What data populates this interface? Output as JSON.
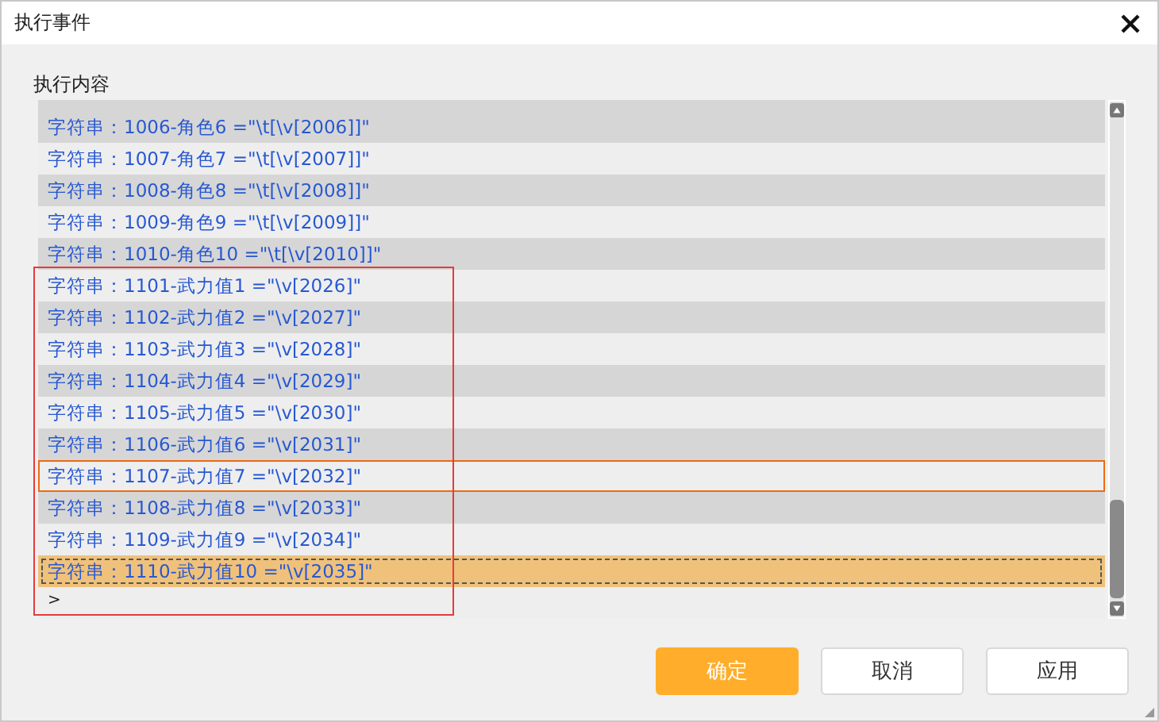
{
  "window": {
    "title": "执行事件"
  },
  "content": {
    "label": "执行内容",
    "rows": [
      {
        "kind": "command",
        "text": "字符串：1006-角色6 =\"\\t[\\v[2006]]\"",
        "selected": false,
        "focused": false
      },
      {
        "kind": "command",
        "text": "字符串：1007-角色7 =\"\\t[\\v[2007]]\"",
        "selected": false,
        "focused": false
      },
      {
        "kind": "command",
        "text": "字符串：1008-角色8 =\"\\t[\\v[2008]]\"",
        "selected": false,
        "focused": false
      },
      {
        "kind": "command",
        "text": "字符串：1009-角色9 =\"\\t[\\v[2009]]\"",
        "selected": false,
        "focused": false
      },
      {
        "kind": "command",
        "text": "字符串：1010-角色10 =\"\\t[\\v[2010]]\"",
        "selected": false,
        "focused": false
      },
      {
        "kind": "command",
        "text": "字符串：1101-武力值1 =\"\\v[2026]\"",
        "selected": false,
        "focused": false
      },
      {
        "kind": "command",
        "text": "字符串：1102-武力值2 =\"\\v[2027]\"",
        "selected": false,
        "focused": false
      },
      {
        "kind": "command",
        "text": "字符串：1103-武力值3 =\"\\v[2028]\"",
        "selected": false,
        "focused": false
      },
      {
        "kind": "command",
        "text": "字符串：1104-武力值4 =\"\\v[2029]\"",
        "selected": false,
        "focused": false
      },
      {
        "kind": "command",
        "text": "字符串：1105-武力值5 =\"\\v[2030]\"",
        "selected": false,
        "focused": false
      },
      {
        "kind": "command",
        "text": "字符串：1106-武力值6 =\"\\v[2031]\"",
        "selected": false,
        "focused": false
      },
      {
        "kind": "command",
        "text": "字符串：1107-武力值7 =\"\\v[2032]\"",
        "selected": false,
        "focused": true
      },
      {
        "kind": "command",
        "text": "字符串：1108-武力值8 =\"\\v[2033]\"",
        "selected": false,
        "focused": false
      },
      {
        "kind": "command",
        "text": "字符串：1109-武力值9 =\"\\v[2034]\"",
        "selected": false,
        "focused": false
      },
      {
        "kind": "command",
        "text": "字符串：1110-武力值10 =\"\\v[2035]\"",
        "selected": true,
        "focused": false
      },
      {
        "kind": "insert",
        "text": ">",
        "selected": false,
        "focused": false
      }
    ]
  },
  "buttons": [
    {
      "label": "确定",
      "primary": true
    },
    {
      "label": "取消",
      "primary": false
    },
    {
      "label": "应用",
      "primary": false
    }
  ]
}
